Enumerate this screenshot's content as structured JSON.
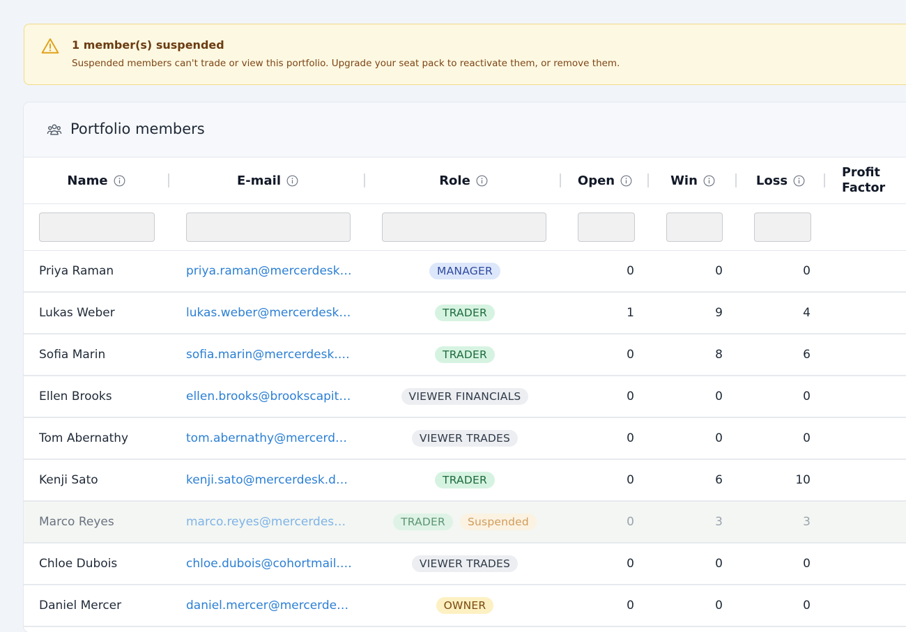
{
  "alert": {
    "title": "1 member(s) suspended",
    "message": "Suspended members can't trade or view this portfolio. Upgrade your seat pack to reactivate them, or remove them.",
    "icon": "warning-triangle-icon",
    "color": "#e0a11b"
  },
  "card": {
    "title": "Portfolio members",
    "icon": "members-icon"
  },
  "columns": {
    "name": "Name",
    "email": "E-mail",
    "role": "Role",
    "open": "Open",
    "win": "Win",
    "loss": "Loss",
    "profit_factor_line1": "Profit",
    "profit_factor_line2": "Factor"
  },
  "filters": {
    "name": "",
    "email": "",
    "role": "",
    "open": "",
    "win": "",
    "loss": ""
  },
  "colors": {
    "link": "#2b7fd4",
    "manager": "#dde7fb",
    "trader": "#d6f3e1",
    "viewer": "#eceef1",
    "owner": "#fdf0c2",
    "suspended": "#fff1dc"
  },
  "rows": [
    {
      "name": "Priya Raman",
      "email": "priya.raman@mercerdesk.d...",
      "role": "MANAGER",
      "role_type": "manager",
      "open": "0",
      "win": "0",
      "loss": "0"
    },
    {
      "name": "Lukas Weber",
      "email": "lukas.weber@mercerdesk.d...",
      "role": "TRADER",
      "role_type": "trader",
      "open": "1",
      "win": "9",
      "loss": "4"
    },
    {
      "name": "Sofia Marin",
      "email": "sofia.marin@mercerdesk.d...",
      "role": "TRADER",
      "role_type": "trader",
      "open": "0",
      "win": "8",
      "loss": "6"
    },
    {
      "name": "Ellen Brooks",
      "email": "ellen.brooks@brookscapita...",
      "role": "VIEWER FINANCIALS",
      "role_type": "viewer",
      "open": "0",
      "win": "0",
      "loss": "0"
    },
    {
      "name": "Tom Abernathy",
      "email": "tom.abernathy@mercerdes...",
      "role": "VIEWER TRADES",
      "role_type": "viewer",
      "open": "0",
      "win": "0",
      "loss": "0"
    },
    {
      "name": "Kenji Sato",
      "email": "kenji.sato@mercerdesk.de...",
      "role": "TRADER",
      "role_type": "trader",
      "open": "0",
      "win": "6",
      "loss": "10"
    },
    {
      "name": "Marco Reyes",
      "email": "marco.reyes@mercerdesk....",
      "role": "TRADER",
      "role_type": "trader",
      "status": "Suspended",
      "open": "0",
      "win": "3",
      "loss": "3"
    },
    {
      "name": "Chloe Dubois",
      "email": "chloe.dubois@cohortmail.d...",
      "role": "VIEWER TRADES",
      "role_type": "viewer",
      "open": "0",
      "win": "0",
      "loss": "0"
    },
    {
      "name": "Daniel Mercer",
      "email": "daniel.mercer@mercerdesk...",
      "role": "OWNER",
      "role_type": "owner",
      "open": "0",
      "win": "0",
      "loss": "0"
    }
  ]
}
